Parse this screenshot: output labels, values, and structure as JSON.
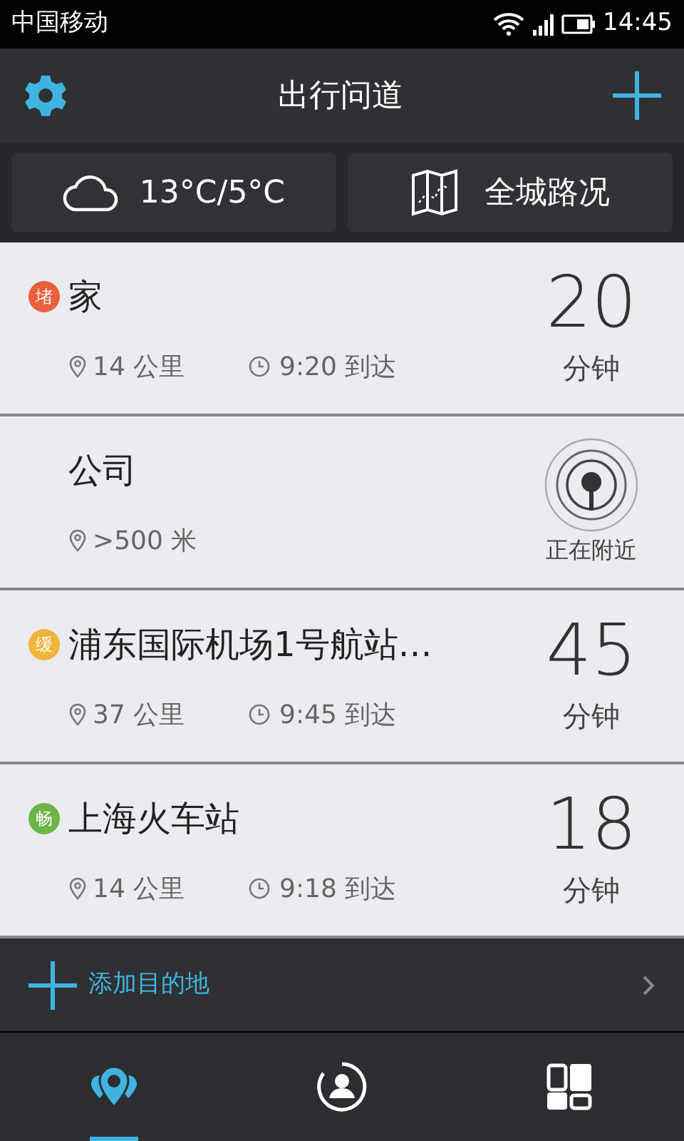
{
  "status_bar": {
    "carrier": "中国移动",
    "time": "14:45"
  },
  "header": {
    "title": "出行问道"
  },
  "weather": {
    "temperature": "13°C/5°C"
  },
  "traffic": {
    "label": "全城路况"
  },
  "destinations": [
    {
      "kind": "eta",
      "name": "家",
      "badge": {
        "text": "堵",
        "color": "#e8603c"
      },
      "distance": "14 公里",
      "arrival": "9:20 到达",
      "minutes": "20",
      "unit": "分钟"
    },
    {
      "kind": "nearby",
      "name": "公司",
      "distance": ">500 米",
      "status": "正在附近"
    },
    {
      "kind": "eta",
      "name": "浦东国际机场1号航站…",
      "badge": {
        "text": "缓",
        "color": "#f0b43a"
      },
      "distance": "37 公里",
      "arrival": "9:45 到达",
      "minutes": "45",
      "unit": "分钟"
    },
    {
      "kind": "eta",
      "name": "上海火车站",
      "badge": {
        "text": "畅",
        "color": "#6cb545"
      },
      "distance": "14 公里",
      "arrival": "9:18 到达",
      "minutes": "18",
      "unit": "分钟"
    }
  ],
  "add_destination": {
    "label": "添加目的地"
  },
  "tabs": [
    {
      "kind": "places",
      "selected": true
    },
    {
      "kind": "profile",
      "selected": false
    },
    {
      "kind": "more",
      "selected": false
    }
  ]
}
